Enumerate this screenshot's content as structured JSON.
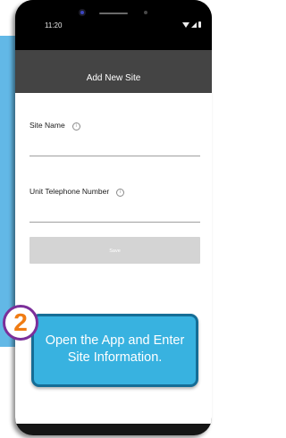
{
  "status_bar": {
    "time": "11:20"
  },
  "app": {
    "header_title": "Add New Site",
    "fields": [
      {
        "label": "Site Name",
        "value": ""
      },
      {
        "label": "Unit Telephone Number",
        "value": ""
      }
    ],
    "save_label": "Save"
  },
  "callout": {
    "step_number": "2",
    "text": "Open the App and Enter Site Information."
  },
  "colors": {
    "background_panel": "#62b8e6",
    "app_header": "#444444",
    "callout_fill": "#38b2e0",
    "callout_border": "#156d96",
    "badge_border": "#7b2f9a",
    "badge_number": "#f07c13"
  }
}
